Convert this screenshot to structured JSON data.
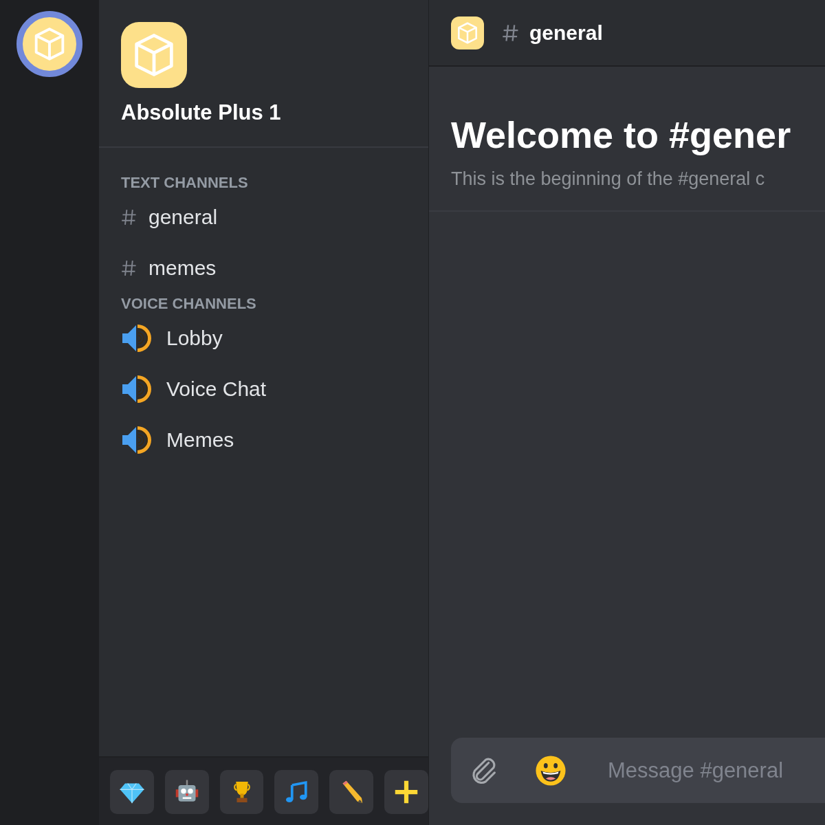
{
  "servers": [
    {
      "selected": true
    }
  ],
  "server": {
    "name": "Absolute Plus 1"
  },
  "channel_groups": [
    {
      "title": "TEXT CHANNELS",
      "kind": "text",
      "channels": [
        {
          "name": "general"
        },
        {
          "name": "memes"
        }
      ]
    },
    {
      "title": "VOICE CHANNELS",
      "kind": "voice",
      "channels": [
        {
          "name": "Lobby"
        },
        {
          "name": "Voice Chat"
        },
        {
          "name": "Memes"
        }
      ]
    }
  ],
  "toolbar": [
    {
      "kind": "diamond"
    },
    {
      "kind": "robot"
    },
    {
      "kind": "trophy"
    },
    {
      "kind": "music"
    },
    {
      "kind": "pencil"
    },
    {
      "kind": "plus"
    }
  ],
  "header": {
    "channel": "general"
  },
  "welcome": {
    "title": "Welcome to #gener",
    "subtitle": "This is the beginning of the #general c"
  },
  "composer": {
    "placeholder": "Message #general"
  }
}
